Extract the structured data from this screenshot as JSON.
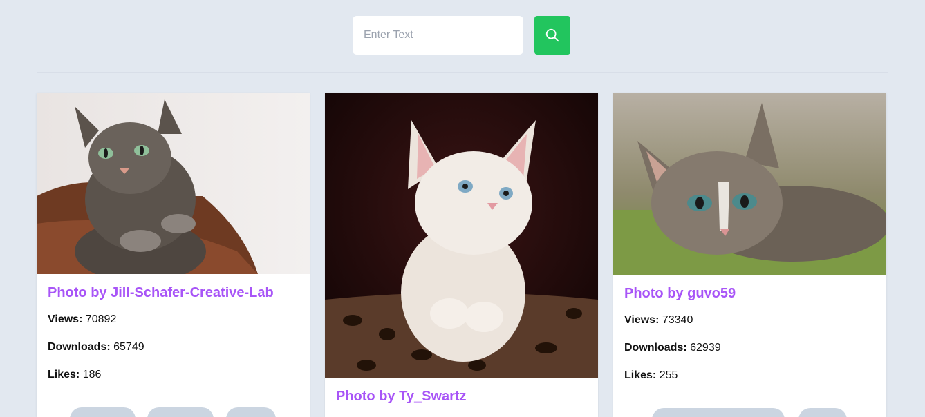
{
  "search": {
    "placeholder": "Enter Text",
    "button_icon": "search-icon",
    "button_color": "#22c55e"
  },
  "accent_color": "#a855f7",
  "labels": {
    "views": "Views:",
    "downloads": "Downloads:",
    "likes": "Likes:"
  },
  "cards": [
    {
      "author": "Photo by Jill-Schafer-Creative-Lab",
      "views": "70892",
      "downloads": "65749",
      "likes": "186",
      "image": "tabby cat resting on brown cushion"
    },
    {
      "author": "Photo by Ty_Swartz",
      "image": "white kitten in leopard-print basket"
    },
    {
      "author": "Photo by guvo59",
      "views": "73340",
      "downloads": "62939",
      "likes": "255",
      "image": "tabby kitten lying on green carpet"
    }
  ]
}
